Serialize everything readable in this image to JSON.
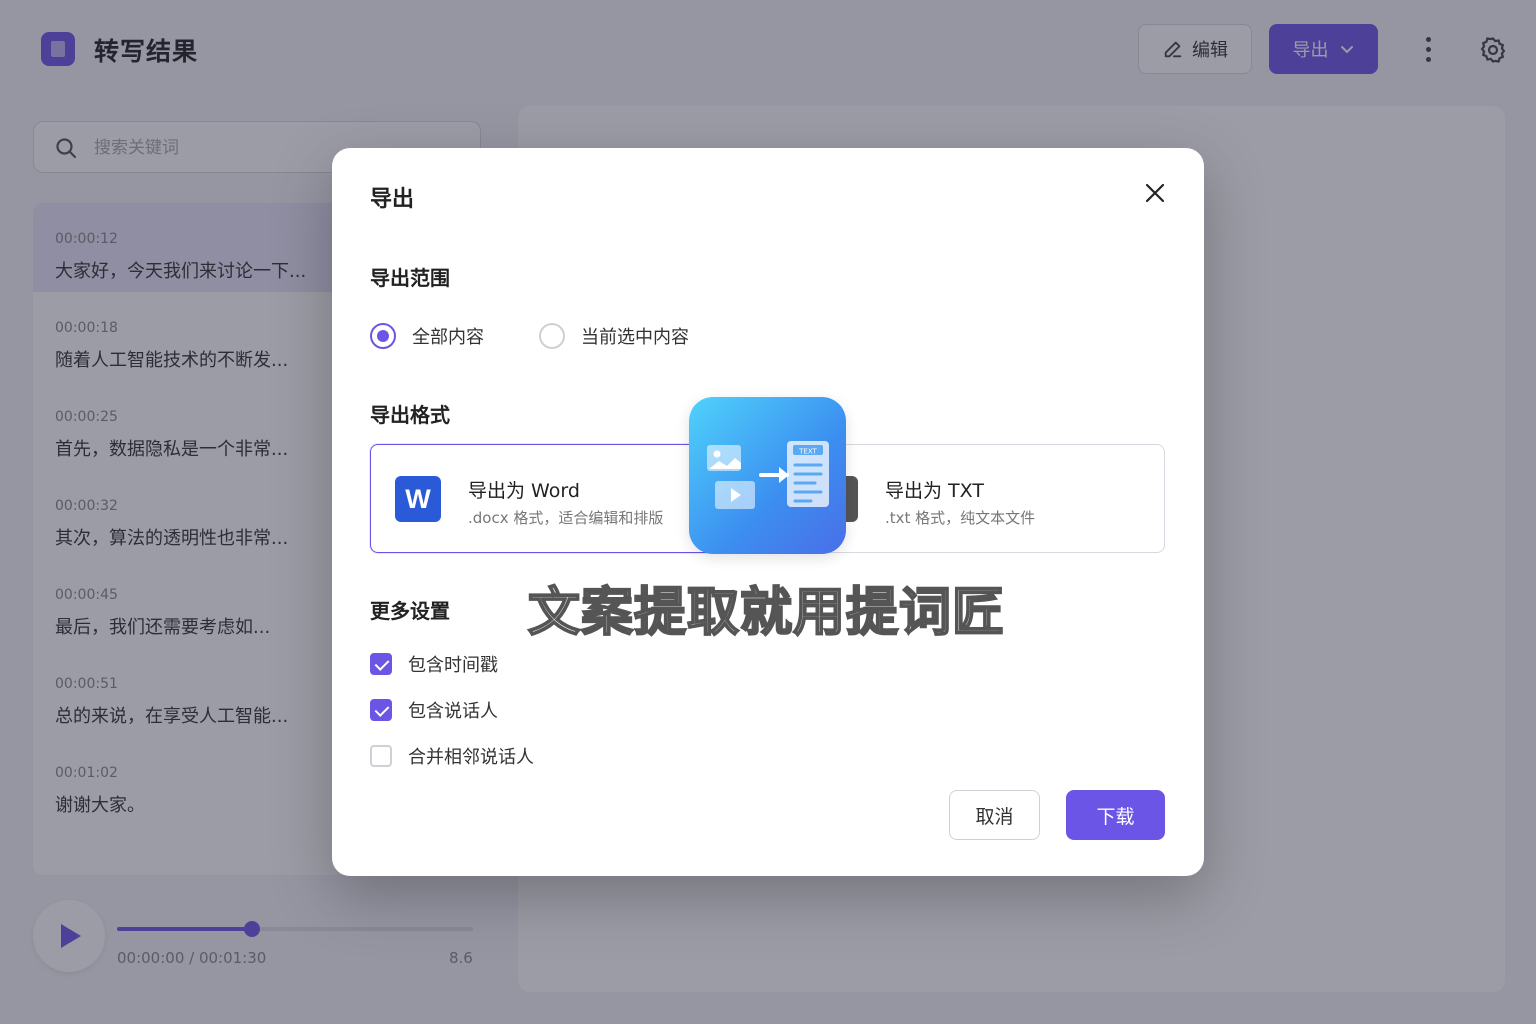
{
  "header": {
    "title": "转写结果",
    "edit_label": "编辑",
    "export_label": "导出"
  },
  "search": {
    "placeholder": "搜索关键词"
  },
  "segments": [
    {
      "time": "00:00:12",
      "text": "大家好，今天我们来讨论一下..."
    },
    {
      "time": "00:00:18",
      "text": "随着人工智能技术的不断发..."
    },
    {
      "time": "00:00:25",
      "text": "首先，数据隐私是一个非常..."
    },
    {
      "time": "00:00:32",
      "text": "其次，算法的透明性也非常..."
    },
    {
      "time": "00:00:45",
      "text": "最后，我们还需要考虑如..."
    },
    {
      "time": "00:00:51",
      "text": "总的来说，在享受人工智能..."
    },
    {
      "time": "00:01:02",
      "text": "谢谢大家。"
    }
  ],
  "player": {
    "time": "00:00:00 / 00:01:30",
    "speed": "8.6",
    "progress": 0.38
  },
  "dialog": {
    "title": "导出",
    "range_title": "导出范围",
    "range_options": [
      "全部内容",
      "当前选中内容"
    ],
    "range_selected": 0,
    "format_title": "导出格式",
    "formats": [
      {
        "icon_letter": "W",
        "name": "导出为 Word",
        "desc": ".docx 格式，适合编辑和排版",
        "selected": true
      },
      {
        "icon_letter": "T",
        "name": "导出为 TXT",
        "desc": ".txt 格式，纯文本文件",
        "selected": false
      }
    ],
    "more_title": "更多设置",
    "options": [
      {
        "label": "包含时间戳",
        "checked": true
      },
      {
        "label": "包含说话人",
        "checked": true
      },
      {
        "label": "合并相邻说话人",
        "checked": false
      }
    ],
    "cancel_label": "取消",
    "download_label": "下载"
  },
  "watermark": {
    "text": "文案提取就用提词匠",
    "icon_label": "TEXT"
  },
  "colors": {
    "accent": "#6b55e6",
    "word_icon": "#2b5ad8",
    "txt_icon": "#555555"
  }
}
